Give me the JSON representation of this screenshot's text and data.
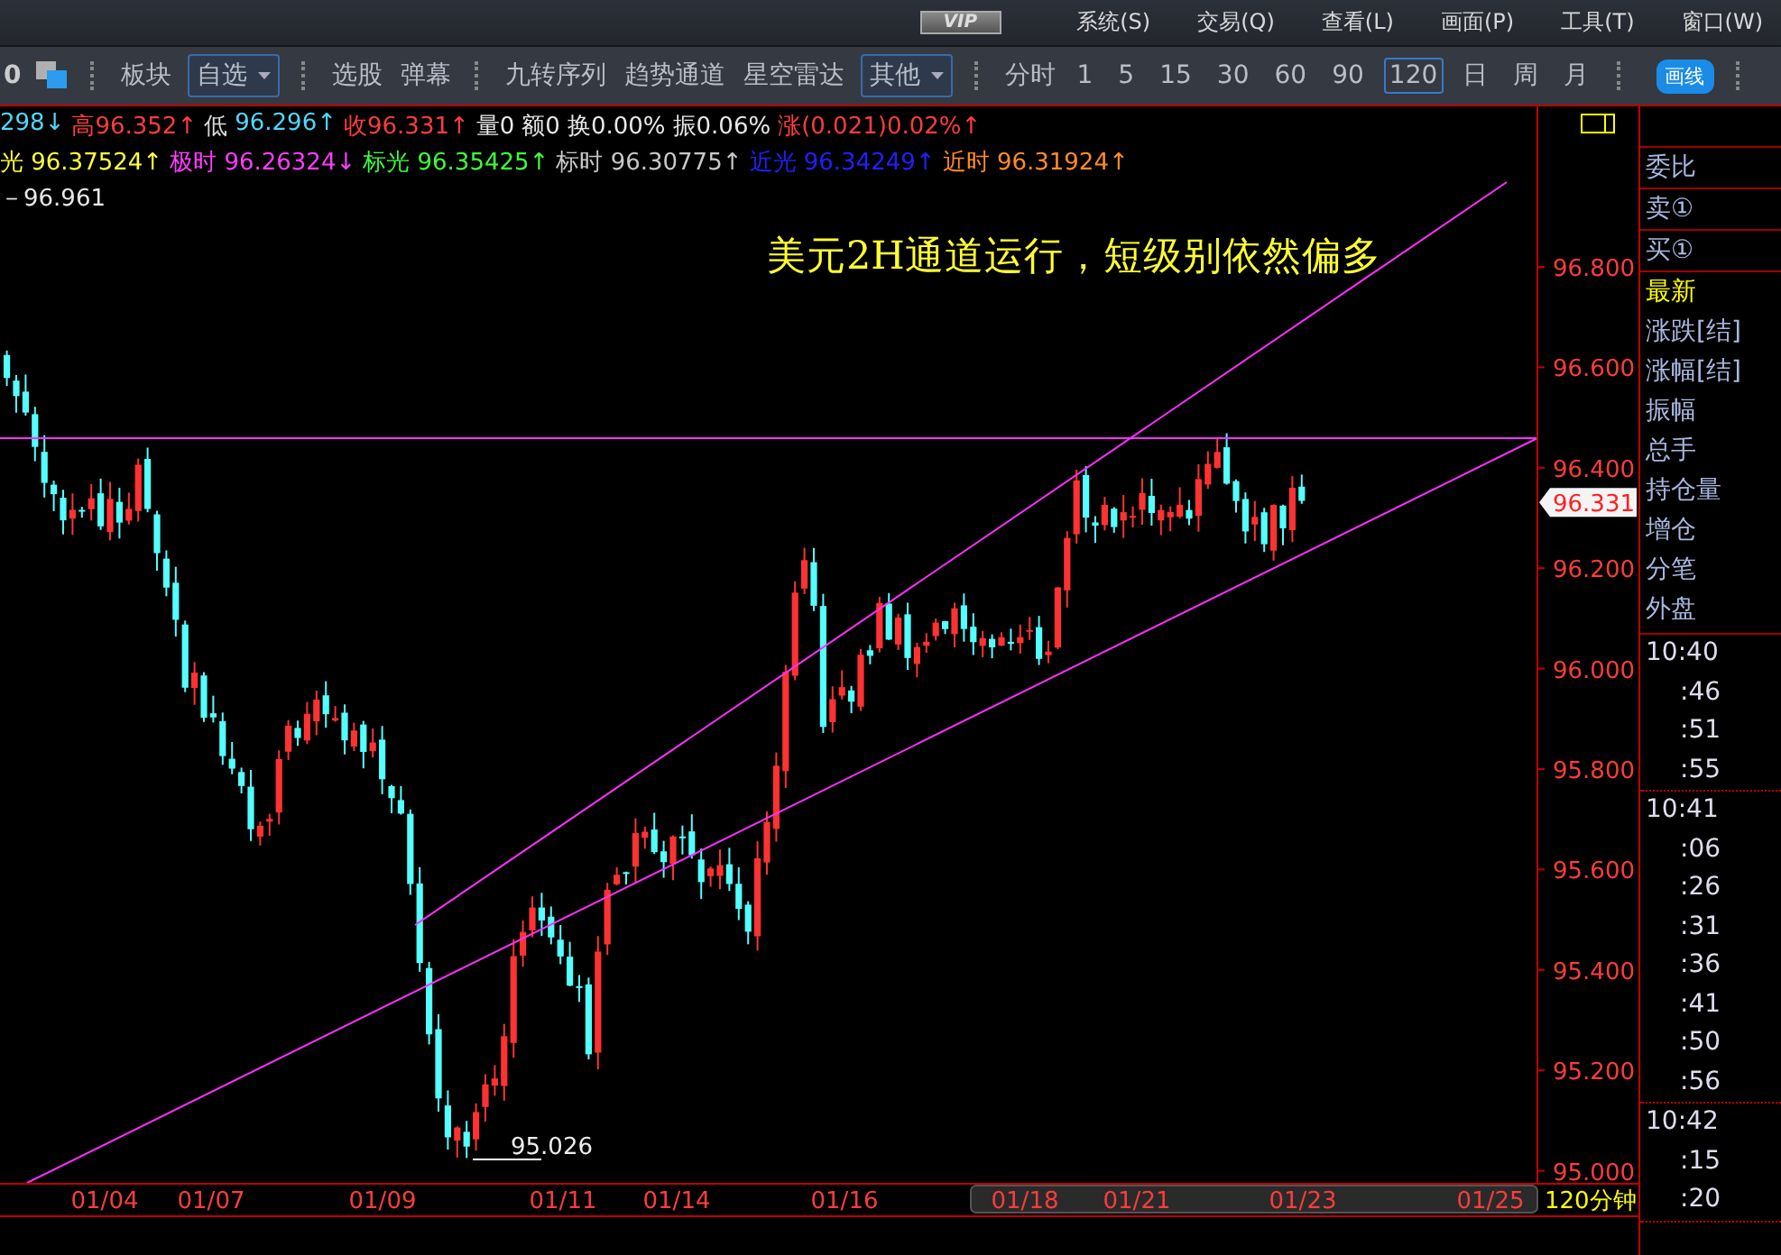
{
  "menu_bar": {
    "badge": "VIP",
    "items": [
      "系统(S)",
      "交易(Q)",
      "查看(L)",
      "画面(P)",
      "工具(T)",
      "窗口(W)"
    ]
  },
  "toolbar": {
    "items": [
      {
        "kind": "text",
        "label": "0"
      },
      {
        "kind": "icon"
      },
      {
        "kind": "separator"
      },
      {
        "kind": "button",
        "label": "板块"
      },
      {
        "kind": "dropdown",
        "label": "自选"
      },
      {
        "kind": "separator"
      },
      {
        "kind": "button",
        "label": "选股"
      },
      {
        "kind": "button",
        "label": "弹幕"
      },
      {
        "kind": "separator"
      },
      {
        "kind": "button",
        "label": "九转序列"
      },
      {
        "kind": "button",
        "label": "趋势通道"
      },
      {
        "kind": "button",
        "label": "星空雷达"
      },
      {
        "kind": "dropdown",
        "label": "其他"
      },
      {
        "kind": "separator"
      },
      {
        "kind": "button",
        "label": "分时"
      }
    ],
    "periods": [
      {
        "label": "1",
        "selected": false
      },
      {
        "label": "5",
        "selected": false
      },
      {
        "label": "15",
        "selected": false
      },
      {
        "label": "30",
        "selected": false
      },
      {
        "label": "60",
        "selected": false
      },
      {
        "label": "90",
        "selected": false
      },
      {
        "label": "120",
        "selected": true
      },
      {
        "label": "日",
        "selected": false
      },
      {
        "label": "周",
        "selected": false
      },
      {
        "label": "月",
        "selected": false
      }
    ],
    "draw_button": "画线"
  },
  "info_lines": [
    [
      {
        "text": "298↓",
        "color": "#4fd8ff"
      },
      {
        "text": "高96.352↑",
        "color": "#ff3c3c"
      },
      {
        "text": "低",
        "color": "#d8d8d8"
      },
      {
        "text": "96.296↑",
        "color": "#4fd8ff"
      },
      {
        "text": "收96.331↑",
        "color": "#ff3c3c"
      },
      {
        "text": "量0",
        "color": "#e8e8e8"
      },
      {
        "text": "额0",
        "color": "#e8e8e8"
      },
      {
        "text": "换0.00%",
        "color": "#e8e8e8"
      },
      {
        "text": "振0.06%",
        "color": "#e8e8e8"
      },
      {
        "text": "涨(0.021)0.02%↑",
        "color": "#ff3c3c"
      }
    ],
    [
      {
        "text": "光 96.37524↑",
        "color": "#ffff3c"
      },
      {
        "text": "极时 96.26324↓",
        "color": "#ff3cff"
      },
      {
        "text": "标光 96.35425↑",
        "color": "#3cff3c"
      },
      {
        "text": "标时 96.30775↑",
        "color": "#c8c8c8"
      },
      {
        "text": "近光 96.34249↑",
        "color": "#2020ff"
      },
      {
        "text": "近时 96.31924↑",
        "color": "#ff8c28"
      }
    ],
    [
      {
        "text": "－96.961",
        "color": "#e8e8e8"
      }
    ]
  ],
  "chart": {
    "annotation": "美元2H通道运行，短级别依然偏多",
    "low_label": "95.026",
    "price_tag": "96.331",
    "y_labels": [
      "96.800",
      "96.600",
      "96.400",
      "96.200",
      "96.000",
      "95.800",
      "95.600",
      "95.400",
      "95.200",
      "95.000"
    ],
    "x_labels": [
      "01/04",
      "01/07",
      "01/09",
      "01/11",
      "01/14",
      "01/16",
      "01/18",
      "01/21",
      "01/23",
      "01/25"
    ],
    "period_label": "120分钟"
  },
  "side_panel": {
    "top_rows": [
      "委比",
      "卖①",
      "买①"
    ],
    "fields": [
      {
        "label": "最新",
        "highlighted": true
      },
      {
        "label": "涨跌[结]",
        "highlighted": false
      },
      {
        "label": "涨幅[结]",
        "highlighted": false
      },
      {
        "label": "振幅",
        "highlighted": false
      },
      {
        "label": "总手",
        "highlighted": false
      },
      {
        "label": "持仓量",
        "highlighted": false
      },
      {
        "label": "增仓",
        "highlighted": false
      },
      {
        "label": "分笔",
        "highlighted": false
      },
      {
        "label": "外盘",
        "highlighted": false
      }
    ],
    "ticks": [
      {
        "time": "10:40",
        "seconds": [
          ":46",
          ":51",
          ":55"
        ]
      },
      {
        "time": "10:41",
        "seconds": [
          ":06",
          ":26",
          ":31",
          ":36",
          ":41",
          ":50",
          ":56"
        ]
      },
      {
        "time": "10:42",
        "seconds": [
          ":15",
          ":20"
        ]
      }
    ]
  }
}
